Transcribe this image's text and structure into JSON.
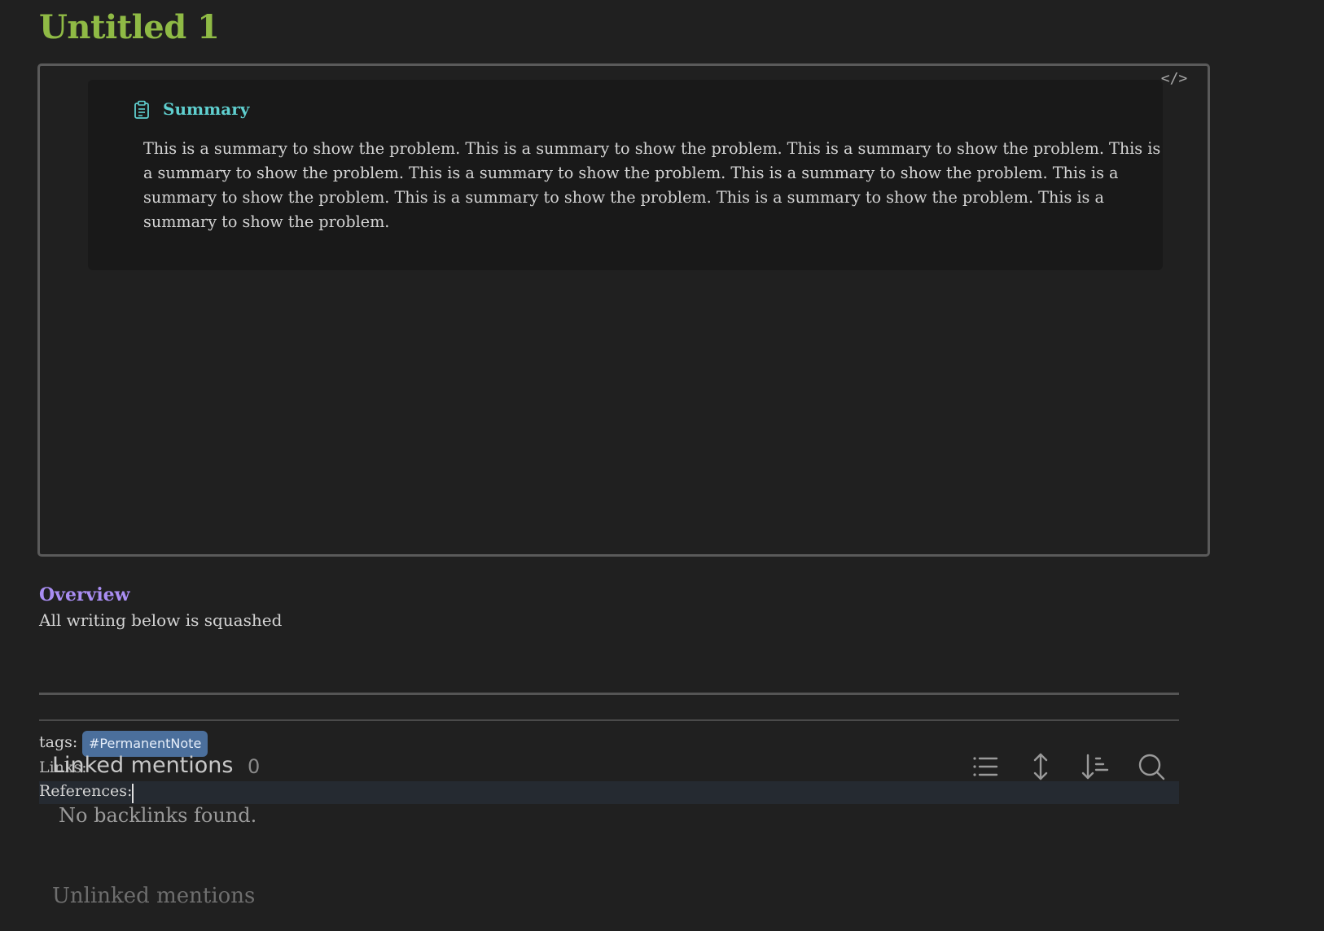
{
  "note": {
    "title": "Untitled 1"
  },
  "embed": {
    "code_toggle_label": "</>",
    "callout": {
      "icon": "clipboard-list-icon",
      "title": "Summary",
      "body": "This is a summary to show the problem. This is a summary to show the problem. This is a summary to show the problem. This is a summary to show the problem. This is a summary to show the problem. This is a summary to show the problem. This is a summary to show the problem. This is a summary to show the problem. This is a summary to show the problem. This is a summary to show the problem."
    }
  },
  "overview": {
    "heading": "Overview",
    "text": "All writing below is squashed"
  },
  "properties": {
    "tags_label": "tags:",
    "tag": "#PermanentNote",
    "links_label": "Links:",
    "references_label": "References:"
  },
  "backlinks": {
    "linked_title": "Linked mentions",
    "linked_count": "0",
    "empty_message": "No backlinks found.",
    "unlinked_title": "Unlinked mentions",
    "toolbar_icons": [
      "list-icon",
      "expand-vertical-icon",
      "sort-icon",
      "search-icon"
    ]
  },
  "colors": {
    "background": "#202020",
    "title": "#8fba45",
    "callout_title": "#5fcfcf",
    "overview_heading": "#a98df2",
    "tag_background": "#4b6f9c"
  }
}
